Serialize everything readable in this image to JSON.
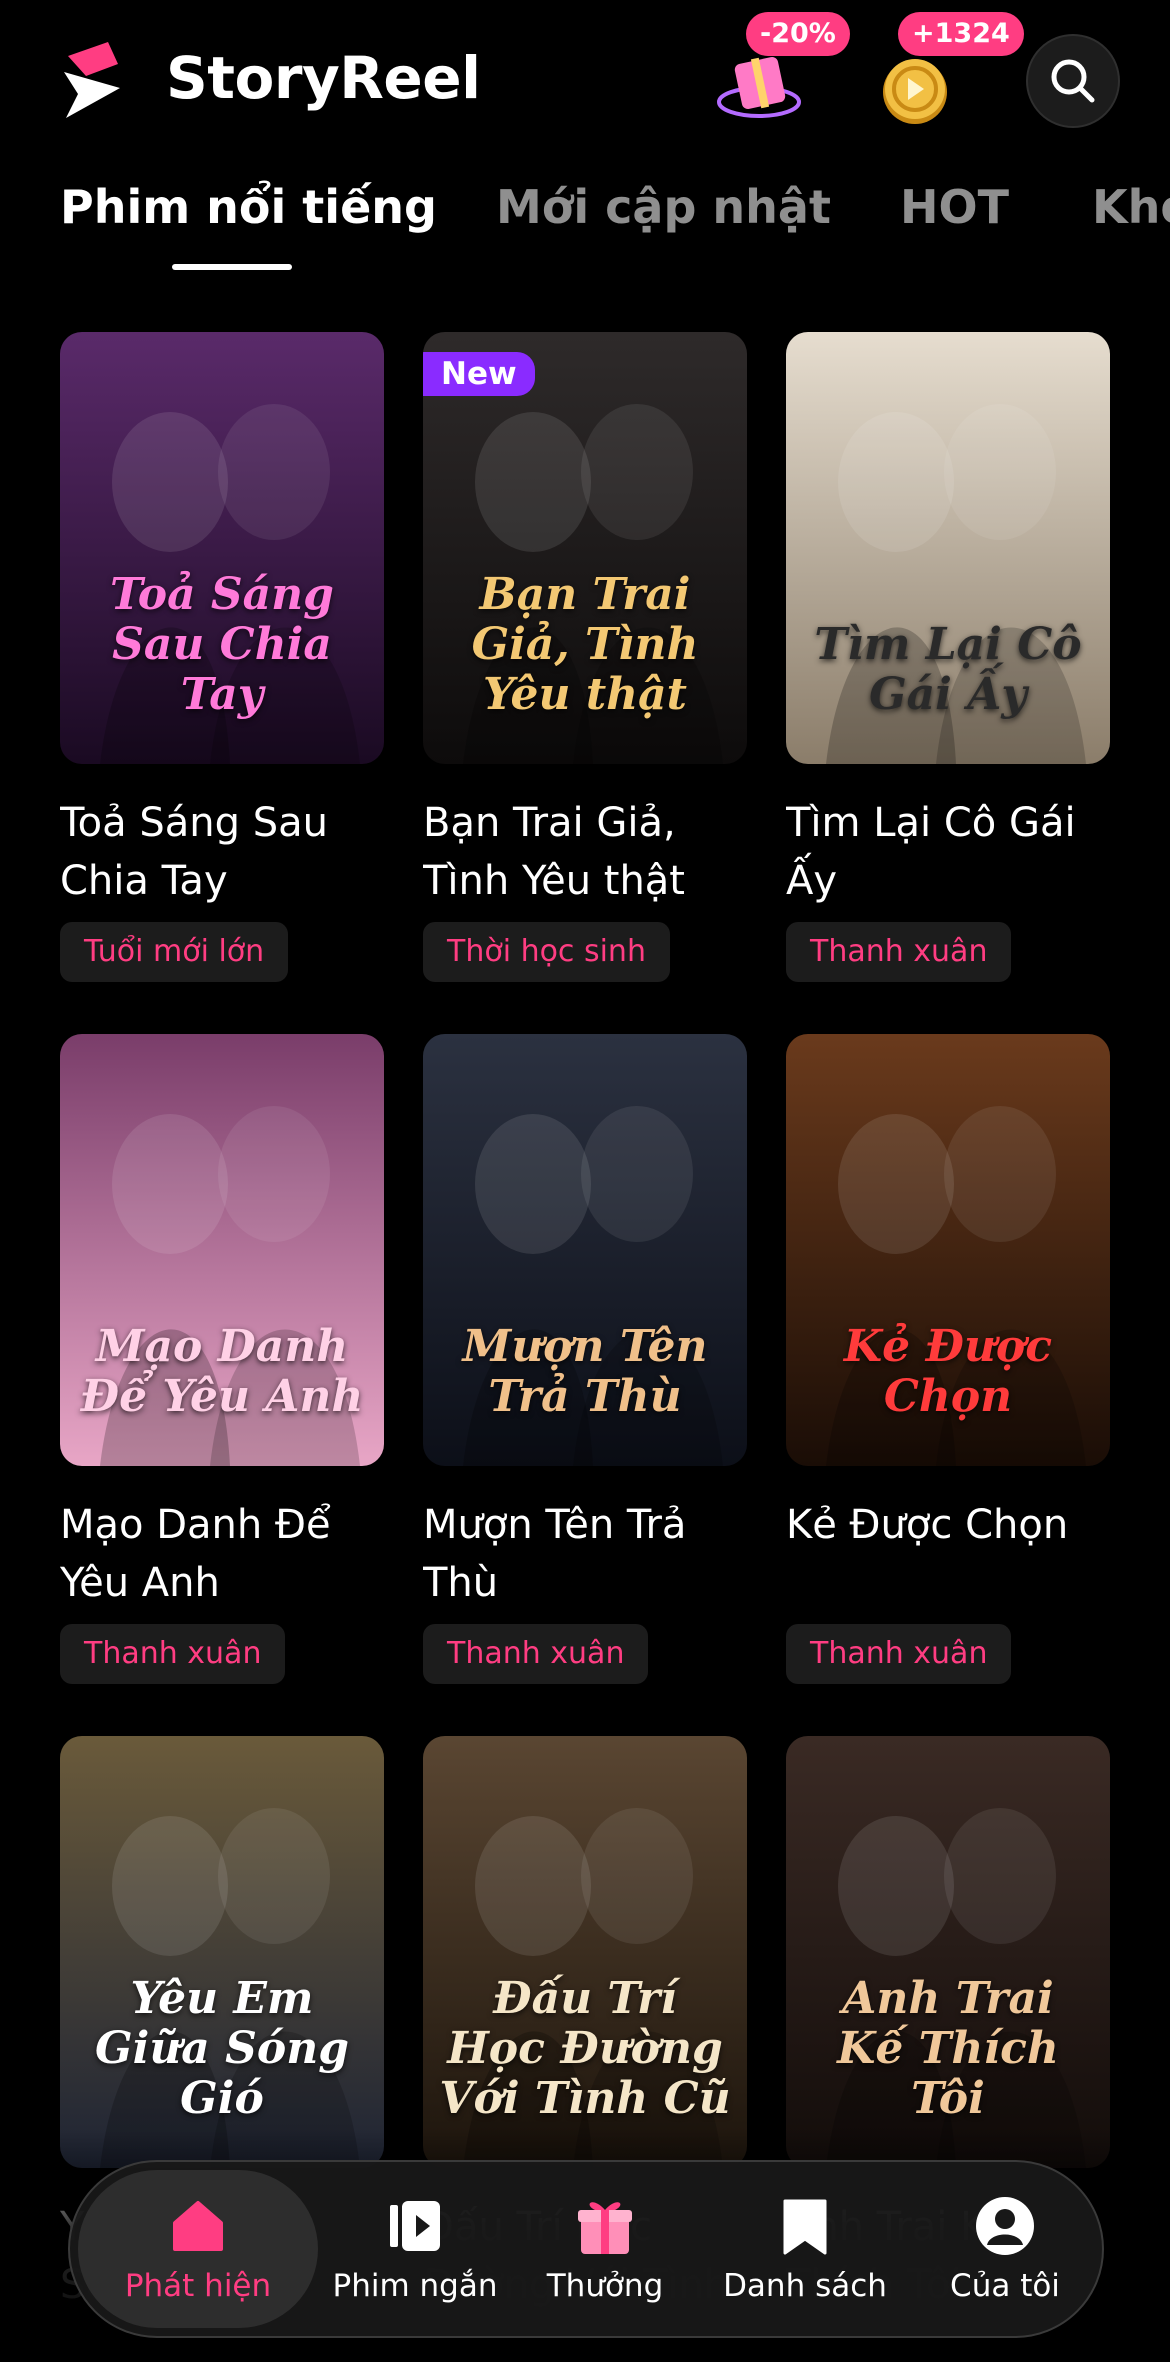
{
  "header": {
    "app_name": "StoryReel",
    "discount_badge": "-20%",
    "coins_badge": "+1324",
    "icons": [
      "storyreel-logo-icon",
      "gift-box-icon",
      "coin-icon",
      "search-icon"
    ]
  },
  "tabs": [
    {
      "label": "Phim nổi tiếng",
      "active": true
    },
    {
      "label": "Mới cập nhật",
      "active": false
    },
    {
      "label": "HOT",
      "active": false
    },
    {
      "label": "Kho",
      "active": false
    }
  ],
  "cards": [
    {
      "title": "Toả Sáng Sau Chia Tay",
      "poster_text": "Toả Sáng Sau Chia Tay",
      "tag": "Tuổi mới lớn",
      "badge": "",
      "color_top": "#5a2a6a",
      "color_bottom": "#1a0a22",
      "title_color": "#ff7ad9"
    },
    {
      "title": "Bạn Trai Giả, Tình Yêu thật",
      "poster_text": "Bạn Trai Giả, Tình Yêu thật",
      "tag": "Thời học sinh",
      "badge": "New",
      "color_top": "#2e2a2a",
      "color_bottom": "#0d0b0b",
      "title_color": "#f3c873"
    },
    {
      "title": "Tìm Lại Cô Gái Ấy",
      "poster_text": "Tìm Lại Cô Gái Ấy",
      "tag": "Thanh xuân",
      "badge": "",
      "color_top": "#e6ddcf",
      "color_bottom": "#8b7d6a",
      "title_color": "#2a2a2a"
    },
    {
      "title": "Mạo Danh Để Yêu Anh",
      "poster_text": "Mạo Danh Để Yêu Anh",
      "tag": "Thanh xuân",
      "badge": "",
      "color_top": "#7a3d6a",
      "color_bottom": "#e8a6c6",
      "title_color": "#ffd1e6"
    },
    {
      "title": "Mượn Tên Trả Thù",
      "poster_text": "Mượn Tên Trả Thù",
      "tag": "Thanh xuân",
      "badge": "",
      "color_top": "#2b3140",
      "color_bottom": "#0c0f18",
      "title_color": "#f0c08a"
    },
    {
      "title": "Kẻ Được Chọn",
      "poster_text": "Kẻ Được Chọn",
      "tag": "Thanh xuân",
      "badge": "",
      "color_top": "#6a3a1c",
      "color_bottom": "#1a0d06",
      "title_color": "#ff3b3b"
    },
    {
      "title": "Yêu Em Giữa Sóng Gió",
      "poster_text": "Yêu Em Giữa Sóng Gió",
      "tag": "",
      "badge": "",
      "color_top": "#6a5a3a",
      "color_bottom": "#1e2434",
      "title_color": "#ffffff"
    },
    {
      "title": "Đấu Trí Học Đường Với Tình Cũ",
      "poster_text": "Đấu Trí Học Đường Với Tình Cũ",
      "tag": "",
      "badge": "",
      "color_top": "#5a4632",
      "color_bottom": "#1c140c",
      "title_color": "#f5e6c8"
    },
    {
      "title": "Anh Trai Kế Thích Tôi",
      "poster_text": "Anh Trai Kế Thích Tôi",
      "tag": "",
      "badge": "",
      "color_top": "#3a2a24",
      "color_bottom": "#120c0a",
      "title_color": "#f0c89a"
    }
  ],
  "nav": [
    {
      "label": "Phát hiện",
      "icon": "home-icon",
      "active": true
    },
    {
      "label": "Phim ngắn",
      "icon": "short-film-icon",
      "active": false
    },
    {
      "label": "Thưởng",
      "icon": "reward-gift-icon",
      "active": false
    },
    {
      "label": "Danh sách",
      "icon": "bookmark-icon",
      "active": false
    },
    {
      "label": "Của tôi",
      "icon": "profile-icon",
      "active": false
    }
  ],
  "colors": {
    "accent": "#ff3d82",
    "new_badge": "#8a2bff",
    "background": "#000000"
  }
}
